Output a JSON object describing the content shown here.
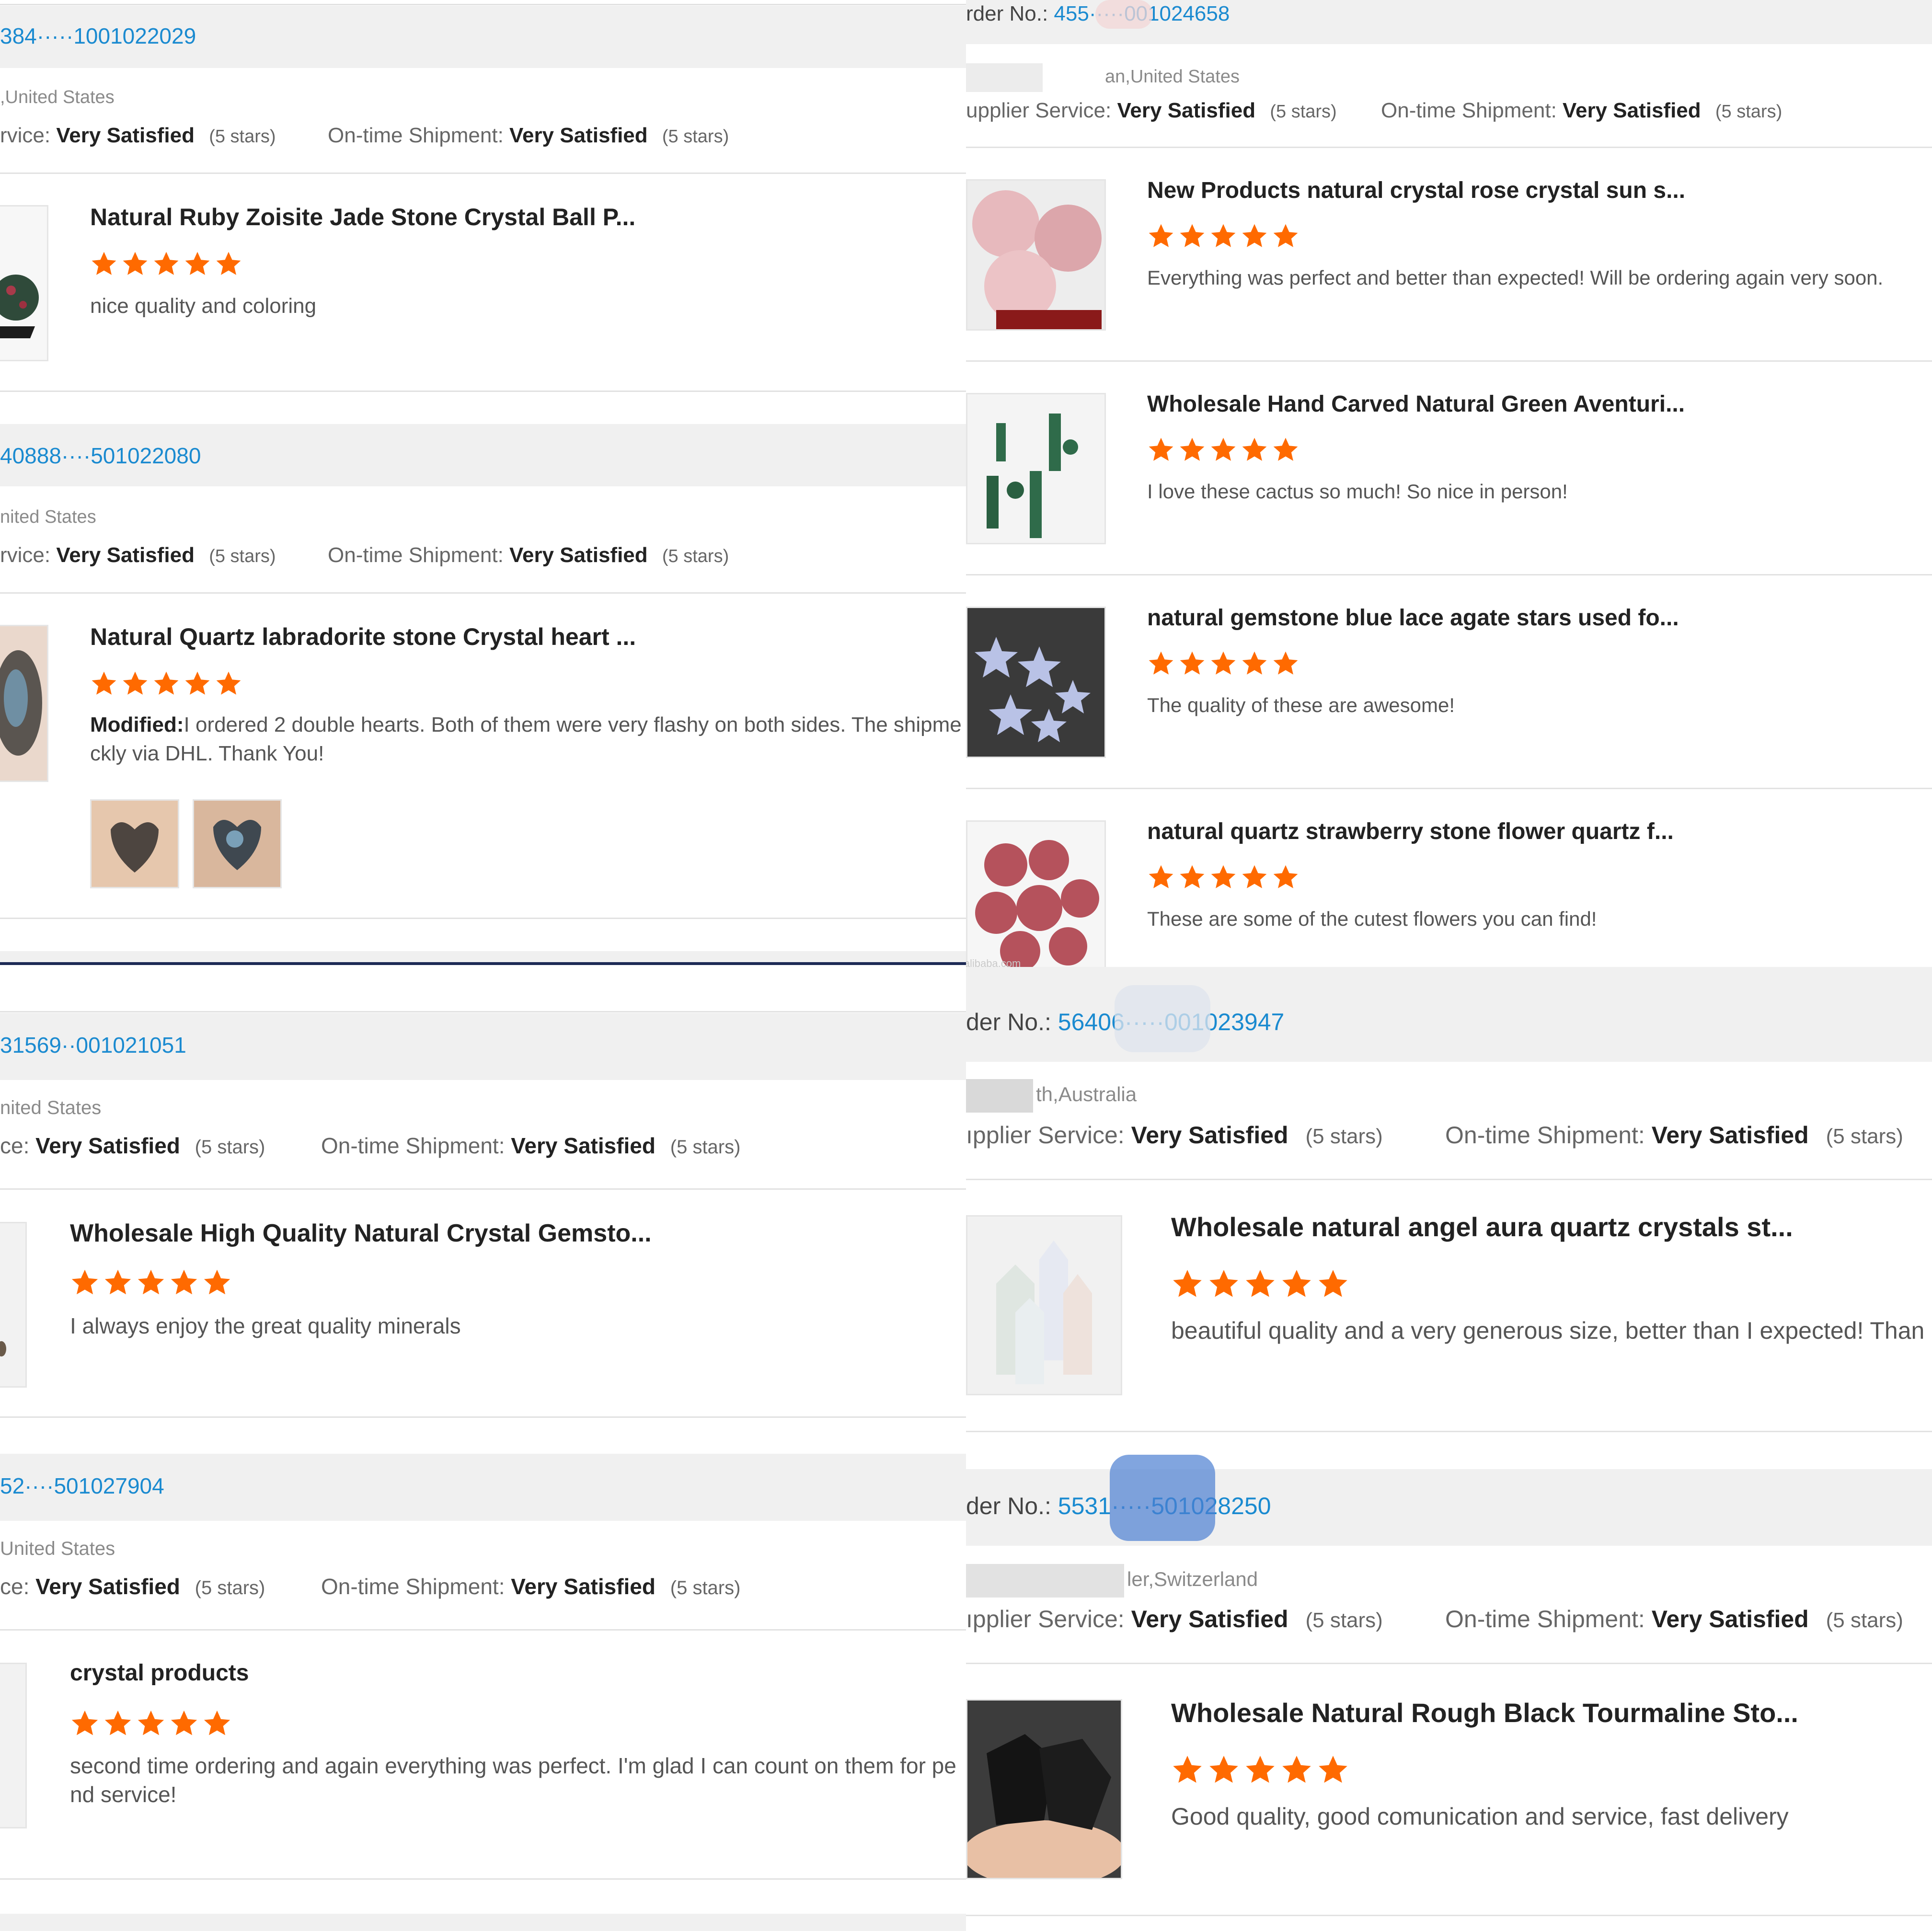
{
  "colors": {
    "star": "#ff6a00",
    "order_link": "#1a8ad0"
  },
  "star_icon": "star-icon",
  "left_top": [
    {
      "order_number": "384·····1001022029",
      "location": ",United States",
      "service_label": "rvice:",
      "service_value": "Very Satisfied",
      "service_stars": "(5 stars)",
      "shipment_label": "On-time Shipment:",
      "shipment_value": "Very Satisfied",
      "shipment_stars": "(5 stars)",
      "product_title": "Natural Ruby Zoisite Jade Stone Crystal Ball P...",
      "rating": 5,
      "review_line1": "nice quality and coloring"
    },
    {
      "order_number": "40888····501022080",
      "location": "nited States",
      "service_label": "rvice:",
      "service_value": "Very Satisfied",
      "service_stars": "(5 stars)",
      "shipment_label": "On-time Shipment:",
      "shipment_value": "Very Satisfied",
      "shipment_stars": "(5 stars)",
      "product_title": "Natural Quartz labradorite stone Crystal heart ...",
      "rating": 5,
      "modified_label": "Modified:",
      "review_line1": "I ordered 2 double hearts.  Both of them were very flashy on both sides. The shipme",
      "review_line2": "ckly via DHL. Thank You!"
    }
  ],
  "left_bottom": [
    {
      "order_number": "31569··001021051",
      "location": "nited States",
      "service_label": "ce:",
      "service_value": "Very Satisfied",
      "service_stars": "(5 stars)",
      "shipment_label": "On-time Shipment:",
      "shipment_value": "Very Satisfied",
      "shipment_stars": "(5 stars)",
      "product_title": "Wholesale High Quality Natural Crystal Gemsto...",
      "rating": 5,
      "review_line1": "I always enjoy the great quality minerals"
    },
    {
      "order_number": "52····501027904",
      "location": "United States",
      "service_label": "ce:",
      "service_value": "Very Satisfied",
      "service_stars": "(5 stars)",
      "shipment_label": "On-time Shipment:",
      "shipment_value": "Very Satisfied",
      "shipment_stars": "(5 stars)",
      "product_title": "crystal products",
      "rating": 5,
      "review_line1": "second time ordering and again everything was perfect. I'm glad I can count on them for pe",
      "review_line2": "nd service!"
    }
  ],
  "right_top": {
    "order_label": "rder No.:",
    "order_number": "455·····001024658",
    "location": "an,United States",
    "service_label": "upplier Service:",
    "service_value": "Very Satisfied",
    "service_stars": "(5 stars)",
    "shipment_label": "On-time Shipment:",
    "shipment_value": "Very Satisfied",
    "shipment_stars": "(5 stars)",
    "items": [
      {
        "title": "New Products natural crystal rose crystal sun s...",
        "rating": 5,
        "review": "Everything was perfect and better than expected! Will be ordering again very soon."
      },
      {
        "title": "Wholesale Hand Carved Natural Green Aventuri...",
        "rating": 5,
        "review": "I love these cactus so much! So nice in person!"
      },
      {
        "title": "natural gemstone blue lace agate stars used fo...",
        "rating": 5,
        "review": "The quality of these are awesome!"
      },
      {
        "title": "natural quartz strawberry stone flower quartz f...",
        "rating": 5,
        "review": "These are some of the cutest flowers you can find!"
      }
    ],
    "watermark": "qlcrystalstore.alibaba.com"
  },
  "right_bottom": [
    {
      "order_label": "der No.:",
      "order_number": "56406·····001023947",
      "location": "th,Australia",
      "service_label": "ıpplier Service:",
      "service_value": "Very Satisfied",
      "service_stars": "(5 stars)",
      "shipment_label": "On-time Shipment:",
      "shipment_value": "Very Satisfied",
      "shipment_stars": "(5 stars)",
      "product_title": "Wholesale natural angel aura quartz crystals st...",
      "rating": 5,
      "review_line1": "beautiful quality and a very generous size, better than I expected! Than"
    },
    {
      "order_label": "der No.:",
      "order_number": "5531·····501028250",
      "location": "ler,Switzerland",
      "service_label": "ıpplier Service:",
      "service_value": "Very Satisfied",
      "service_stars": "(5 stars)",
      "shipment_label": "On-time Shipment:",
      "shipment_value": "Very Satisfied",
      "shipment_stars": "(5 stars)",
      "product_title": "Wholesale Natural Rough Black Tourmaline Sto...",
      "rating": 5,
      "review_line1": "Good quality, good comunication and service, fast delivery"
    }
  ]
}
